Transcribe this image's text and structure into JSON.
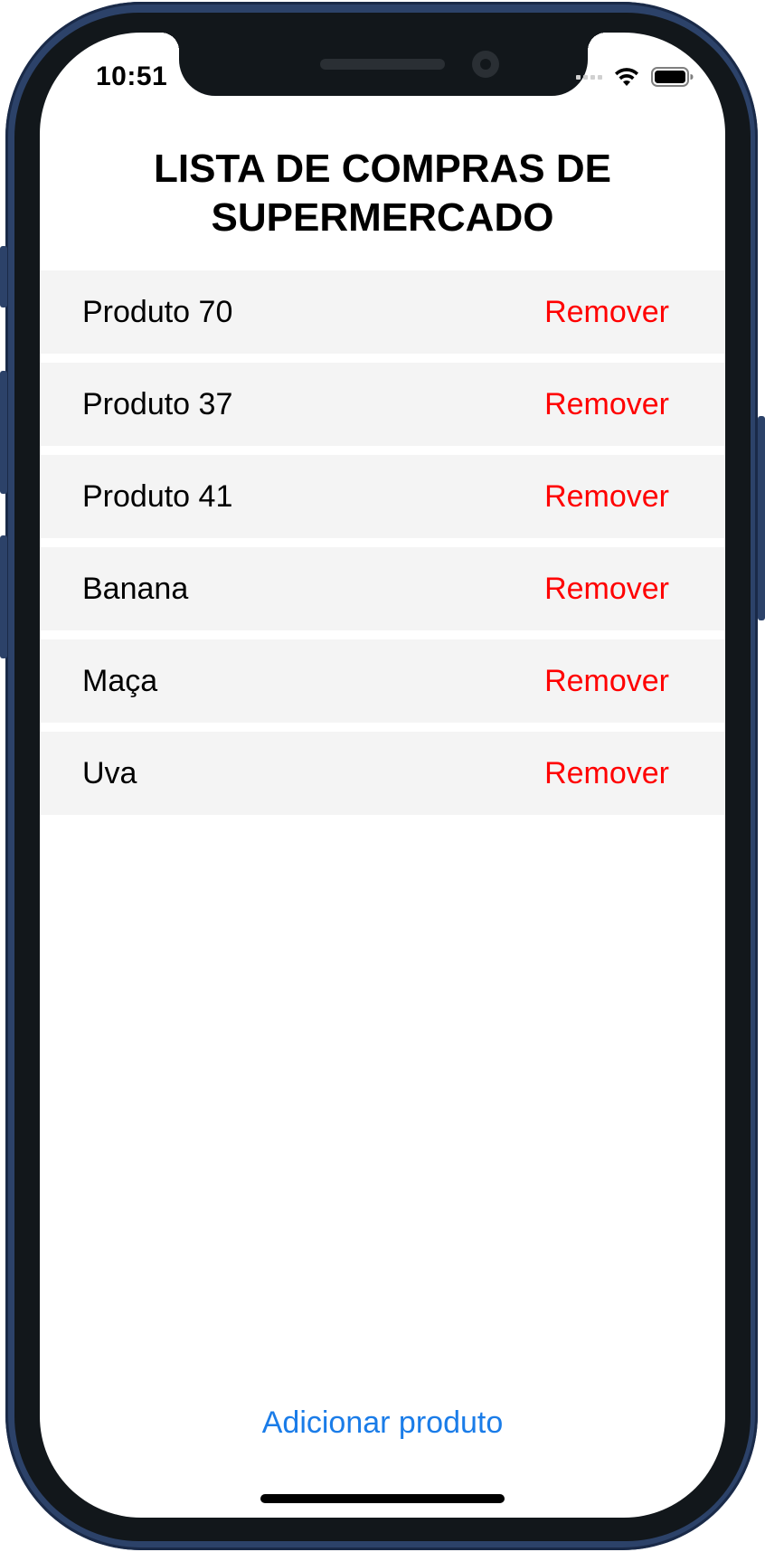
{
  "status_bar": {
    "time": "10:51",
    "icons": [
      "signal-icon",
      "wifi-icon",
      "battery-icon"
    ]
  },
  "header": {
    "title_line1": "LISTA DE COMPRAS DE",
    "title_line2": "SUPERMERCADO"
  },
  "list": {
    "items": [
      {
        "name": "Produto 70",
        "action": "Remover"
      },
      {
        "name": "Produto 37",
        "action": "Remover"
      },
      {
        "name": "Produto 41",
        "action": "Remover"
      },
      {
        "name": "Banana",
        "action": "Remover"
      },
      {
        "name": "Maça",
        "action": "Remover"
      },
      {
        "name": "Uva",
        "action": "Remover"
      }
    ]
  },
  "footer": {
    "add_label": "Adicionar produto"
  },
  "colors": {
    "remove": "#ff0000",
    "add": "#1a7ce8",
    "row_background": "#f4f4f4",
    "frame": "#2c4269"
  }
}
